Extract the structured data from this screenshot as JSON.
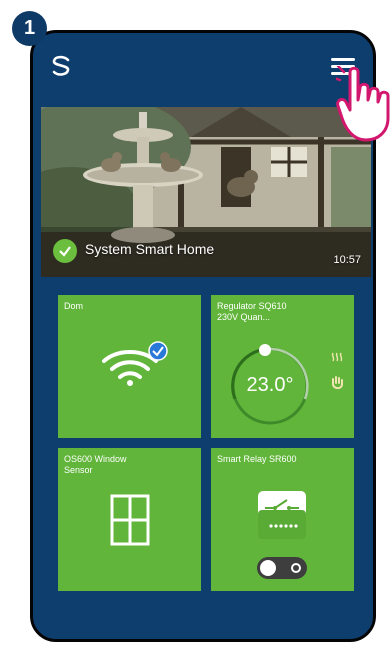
{
  "step": {
    "number": "1"
  },
  "header": {
    "logo_icon": "salus-logo-icon",
    "menu_icon": "hamburger-menu-icon",
    "pointer_icon": "hand-pointer-icon"
  },
  "hero": {
    "title": "System Smart Home",
    "time": "10:57",
    "status_icon": "check-circle-icon"
  },
  "tiles": [
    {
      "title": "Dom",
      "icon": "wifi-icon",
      "badge": "check-badge-icon"
    },
    {
      "title": "Regulator SQ610\n230V Quan...",
      "temperature": "23.0°",
      "icons": [
        "heat-icon",
        "hand-icon"
      ]
    },
    {
      "title": "OS600 Window\nSensor",
      "icon": "window-icon"
    },
    {
      "title": "Smart Relay SR600",
      "icon": "relay-switch-icon",
      "toggle_on": true
    }
  ],
  "colors": {
    "app_bg": "#0d3e6e",
    "tile_green": "#61b53a",
    "badge": "#0d3a66",
    "accent_blue": "#2979d9"
  }
}
